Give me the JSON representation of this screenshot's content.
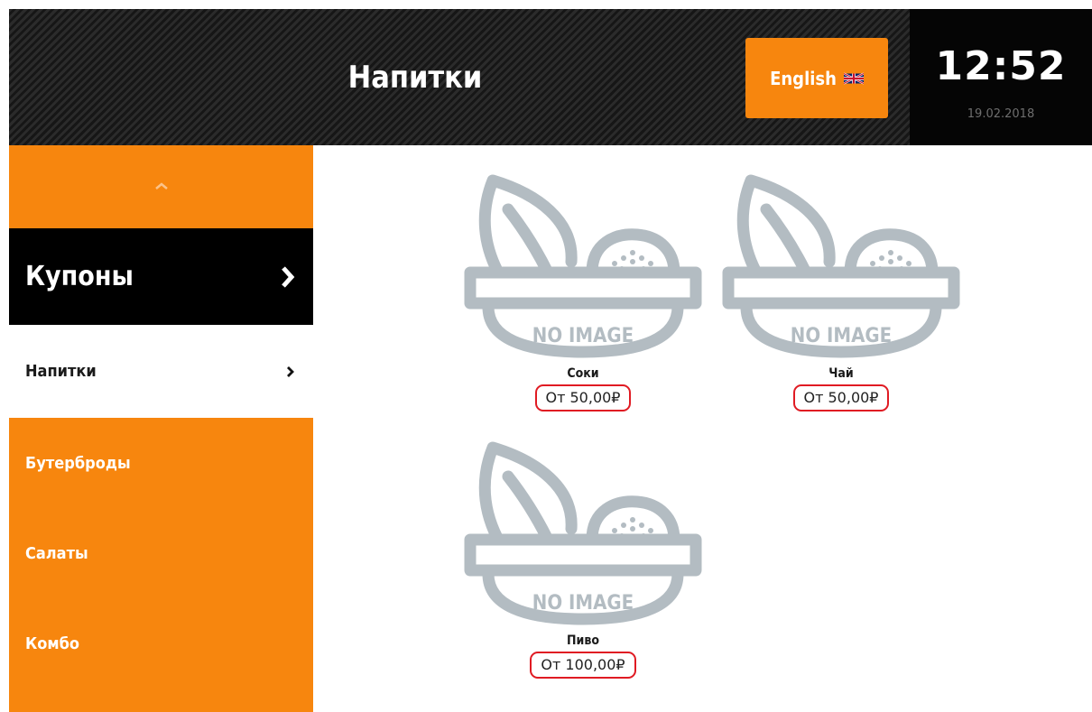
{
  "header": {
    "title": "Напитки",
    "language_button": {
      "label": "English",
      "icon": "uk-flag-icon"
    },
    "clock": {
      "time": "12:52",
      "date": "19.02.2018"
    }
  },
  "sidebar": {
    "scroll_up_icon": "chevron-up-icon",
    "items": [
      {
        "label": "Купоны",
        "state": "highlighted",
        "icon": "chevron-right-icon"
      },
      {
        "label": "Напитки",
        "state": "selected",
        "icon": "chevron-right-icon"
      },
      {
        "label": "Бутерброды"
      },
      {
        "label": "Салаты"
      },
      {
        "label": "Комбо"
      }
    ]
  },
  "products": [
    {
      "name": "Соки",
      "price": "От 50,00₽",
      "image_text": "NO IMAGE"
    },
    {
      "name": "Чай",
      "price": "От 50,00₽",
      "image_text": "NO IMAGE"
    },
    {
      "name": "Пиво",
      "price": "От 100,00₽",
      "image_text": "NO IMAGE"
    }
  ],
  "colors": {
    "accent": "#f7860e",
    "header_bg": "#262626",
    "highlight_bg": "#000000",
    "price_outline": "#e01b23",
    "placeholder_gray": "#b3bcc2"
  }
}
